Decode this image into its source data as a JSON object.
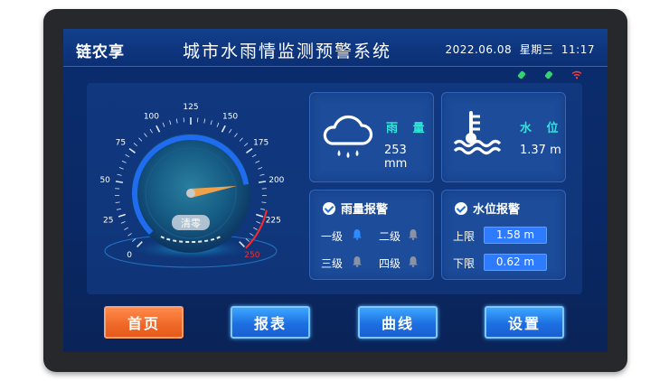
{
  "header": {
    "logo": "链农享",
    "title": "城市水雨情监测预警系统",
    "datetime": "2022.06.08  星期三  11:17"
  },
  "status_icons": [
    "plug-icon",
    "plug-icon",
    "wifi-icon"
  ],
  "gauge": {
    "ticks": [
      "0",
      "25",
      "50",
      "75",
      "100",
      "125",
      "150",
      "175",
      "200",
      "225",
      "250"
    ],
    "min": 0,
    "max": 250,
    "value": 200,
    "reset_label": "清零",
    "colors": {
      "arc": "#1f6cf0",
      "redline": "#ff2a2a",
      "needle": "#f0a24a"
    }
  },
  "rain": {
    "label": "雨 量",
    "value": "253 mm",
    "icon": "rain-cloud-icon"
  },
  "water": {
    "label": "水 位",
    "value": "1.37 m",
    "icon": "water-level-icon"
  },
  "rain_alarm": {
    "title": "雨量报警",
    "levels": [
      {
        "label": "一级",
        "active": true
      },
      {
        "label": "二级",
        "active": false
      },
      {
        "label": "三级",
        "active": false
      },
      {
        "label": "四级",
        "active": false
      }
    ]
  },
  "water_alarm": {
    "title": "水位报警",
    "upper_label": "上限",
    "upper_value": "1.58 m",
    "lower_label": "下限",
    "lower_value": "0.62 m"
  },
  "nav": [
    {
      "label": "首页",
      "active": true
    },
    {
      "label": "报表",
      "active": false
    },
    {
      "label": "曲线",
      "active": false
    },
    {
      "label": "设置",
      "active": false
    }
  ],
  "colors": {
    "accent": "#2ee6d6",
    "active_bell": "#2f8cff",
    "inactive_bell": "#8a93a6"
  }
}
